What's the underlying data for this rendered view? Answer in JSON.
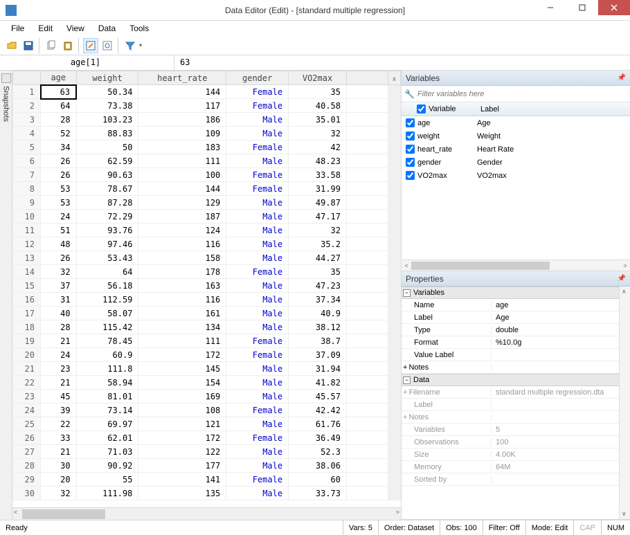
{
  "window": {
    "title": "Data Editor (Edit) - [standard multiple regression]"
  },
  "menu": [
    "File",
    "Edit",
    "View",
    "Data",
    "Tools"
  ],
  "cellref": {
    "name": "age[1]",
    "value": "63"
  },
  "columns": [
    "age",
    "weight",
    "heart_rate",
    "gender",
    "VO2max"
  ],
  "rows": [
    {
      "n": 1,
      "age": "63",
      "weight": "50.34",
      "hr": "144",
      "gender": "Female",
      "vo2": "35"
    },
    {
      "n": 2,
      "age": "64",
      "weight": "73.38",
      "hr": "117",
      "gender": "Female",
      "vo2": "40.58"
    },
    {
      "n": 3,
      "age": "28",
      "weight": "103.23",
      "hr": "186",
      "gender": "Male",
      "vo2": "35.01"
    },
    {
      "n": 4,
      "age": "52",
      "weight": "88.83",
      "hr": "109",
      "gender": "Male",
      "vo2": "32"
    },
    {
      "n": 5,
      "age": "34",
      "weight": "50",
      "hr": "183",
      "gender": "Female",
      "vo2": "42"
    },
    {
      "n": 6,
      "age": "26",
      "weight": "62.59",
      "hr": "111",
      "gender": "Male",
      "vo2": "48.23"
    },
    {
      "n": 7,
      "age": "26",
      "weight": "90.63",
      "hr": "100",
      "gender": "Female",
      "vo2": "33.58"
    },
    {
      "n": 8,
      "age": "53",
      "weight": "78.67",
      "hr": "144",
      "gender": "Female",
      "vo2": "31.99"
    },
    {
      "n": 9,
      "age": "53",
      "weight": "87.28",
      "hr": "129",
      "gender": "Male",
      "vo2": "49.87"
    },
    {
      "n": 10,
      "age": "24",
      "weight": "72.29",
      "hr": "187",
      "gender": "Male",
      "vo2": "47.17"
    },
    {
      "n": 11,
      "age": "51",
      "weight": "93.76",
      "hr": "124",
      "gender": "Male",
      "vo2": "32"
    },
    {
      "n": 12,
      "age": "48",
      "weight": "97.46",
      "hr": "116",
      "gender": "Male",
      "vo2": "35.2"
    },
    {
      "n": 13,
      "age": "26",
      "weight": "53.43",
      "hr": "158",
      "gender": "Male",
      "vo2": "44.27"
    },
    {
      "n": 14,
      "age": "32",
      "weight": "64",
      "hr": "178",
      "gender": "Female",
      "vo2": "35"
    },
    {
      "n": 15,
      "age": "37",
      "weight": "56.18",
      "hr": "163",
      "gender": "Male",
      "vo2": "47.23"
    },
    {
      "n": 16,
      "age": "31",
      "weight": "112.59",
      "hr": "116",
      "gender": "Male",
      "vo2": "37.34"
    },
    {
      "n": 17,
      "age": "40",
      "weight": "58.07",
      "hr": "161",
      "gender": "Male",
      "vo2": "40.9"
    },
    {
      "n": 18,
      "age": "28",
      "weight": "115.42",
      "hr": "134",
      "gender": "Male",
      "vo2": "38.12"
    },
    {
      "n": 19,
      "age": "21",
      "weight": "78.45",
      "hr": "111",
      "gender": "Female",
      "vo2": "38.7"
    },
    {
      "n": 20,
      "age": "24",
      "weight": "60.9",
      "hr": "172",
      "gender": "Female",
      "vo2": "37.09"
    },
    {
      "n": 21,
      "age": "23",
      "weight": "111.8",
      "hr": "145",
      "gender": "Male",
      "vo2": "31.94"
    },
    {
      "n": 22,
      "age": "21",
      "weight": "58.94",
      "hr": "154",
      "gender": "Male",
      "vo2": "41.82"
    },
    {
      "n": 23,
      "age": "45",
      "weight": "81.01",
      "hr": "169",
      "gender": "Male",
      "vo2": "45.57"
    },
    {
      "n": 24,
      "age": "39",
      "weight": "73.14",
      "hr": "108",
      "gender": "Female",
      "vo2": "42.42"
    },
    {
      "n": 25,
      "age": "22",
      "weight": "69.97",
      "hr": "121",
      "gender": "Male",
      "vo2": "61.76"
    },
    {
      "n": 26,
      "age": "33",
      "weight": "62.01",
      "hr": "172",
      "gender": "Female",
      "vo2": "36.49"
    },
    {
      "n": 27,
      "age": "21",
      "weight": "71.03",
      "hr": "122",
      "gender": "Male",
      "vo2": "52.3"
    },
    {
      "n": 28,
      "age": "30",
      "weight": "90.92",
      "hr": "177",
      "gender": "Male",
      "vo2": "38.06"
    },
    {
      "n": 29,
      "age": "20",
      "weight": "55",
      "hr": "141",
      "gender": "Female",
      "vo2": "60"
    },
    {
      "n": 30,
      "age": "32",
      "weight": "111.98",
      "hr": "135",
      "gender": "Male",
      "vo2": "33.73"
    }
  ],
  "variables_panel": {
    "title": "Variables",
    "filter_placeholder": "Filter variables here",
    "header": {
      "col1": "Variable",
      "col2": "Label"
    },
    "items": [
      {
        "name": "age",
        "label": "Age"
      },
      {
        "name": "weight",
        "label": "Weight"
      },
      {
        "name": "heart_rate",
        "label": "Heart Rate"
      },
      {
        "name": "gender",
        "label": "Gender"
      },
      {
        "name": "VO2max",
        "label": "VO2max"
      }
    ]
  },
  "properties_panel": {
    "title": "Properties",
    "sections": {
      "variables": {
        "title": "Variables",
        "rows": [
          {
            "k": "Name",
            "v": "age"
          },
          {
            "k": "Label",
            "v": "Age"
          },
          {
            "k": "Type",
            "v": "double"
          },
          {
            "k": "Format",
            "v": "%10.0g"
          },
          {
            "k": "Value Label",
            "v": ""
          }
        ],
        "notes_label": "Notes"
      },
      "data": {
        "title": "Data",
        "rows": [
          {
            "k": "Filename",
            "v": "standard multiple regression.dta",
            "box": true
          },
          {
            "k": "Label",
            "v": ""
          },
          {
            "k": "Notes",
            "v": "",
            "box": true
          },
          {
            "k": "Variables",
            "v": "5"
          },
          {
            "k": "Observations",
            "v": "100"
          },
          {
            "k": "Size",
            "v": "4.00K"
          },
          {
            "k": "Memory",
            "v": "64M"
          },
          {
            "k": "Sorted by",
            "v": ""
          }
        ]
      }
    }
  },
  "statusbar": {
    "ready": "Ready",
    "vars": "Vars: 5",
    "order": "Order: Dataset",
    "obs": "Obs: 100",
    "filter": "Filter: Off",
    "mode": "Mode: Edit",
    "cap": "CAP",
    "num": "NUM"
  },
  "snapshots_label": "Snapshots"
}
